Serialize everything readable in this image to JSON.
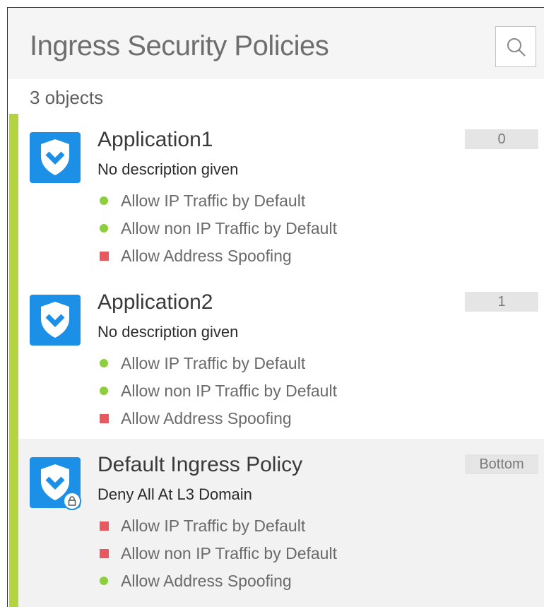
{
  "header": {
    "title": "Ingress Security Policies",
    "search_icon": "search-icon"
  },
  "summary": {
    "count_text": "3 objects"
  },
  "colors": {
    "accent": "#b4d43f",
    "icon_bg": "#1c8fe6",
    "enabled": "#8ccf3c",
    "disabled": "#e8585e"
  },
  "policies": [
    {
      "name": "Application1",
      "description": "No description given",
      "order": "0",
      "locked": false,
      "selected": false,
      "flags": [
        {
          "label": "Allow IP Traffic by Default",
          "state": "enabled"
        },
        {
          "label": "Allow non IP Traffic by Default",
          "state": "enabled"
        },
        {
          "label": "Allow Address Spoofing",
          "state": "disabled"
        }
      ]
    },
    {
      "name": "Application2",
      "description": "No description given",
      "order": "1",
      "locked": false,
      "selected": false,
      "flags": [
        {
          "label": "Allow IP Traffic by Default",
          "state": "enabled"
        },
        {
          "label": "Allow non IP Traffic by Default",
          "state": "enabled"
        },
        {
          "label": "Allow Address Spoofing",
          "state": "disabled"
        }
      ]
    },
    {
      "name": "Default Ingress Policy",
      "description": "Deny All At L3 Domain",
      "order": "Bottom",
      "locked": true,
      "selected": true,
      "flags": [
        {
          "label": "Allow IP Traffic by Default",
          "state": "disabled"
        },
        {
          "label": "Allow non IP Traffic by Default",
          "state": "disabled"
        },
        {
          "label": "Allow Address Spoofing",
          "state": "enabled"
        }
      ]
    }
  ]
}
